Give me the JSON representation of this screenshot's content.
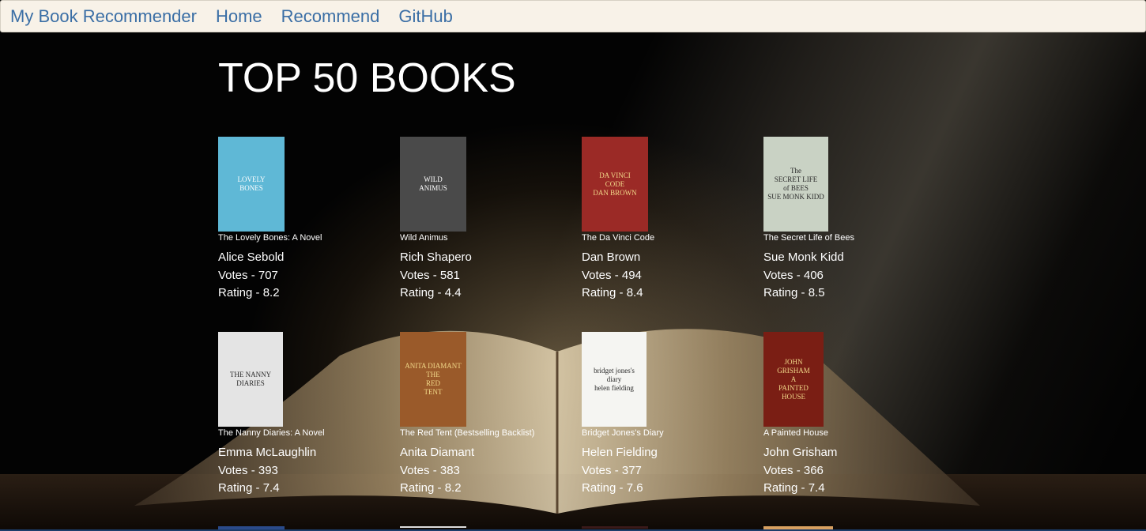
{
  "nav": {
    "brand": "My Book Recommender",
    "links": [
      "Home",
      "Recommend",
      "GitHub"
    ]
  },
  "page": {
    "title": "TOP 50 BOOKS"
  },
  "books": [
    {
      "title": "The Lovely Bones: A Novel",
      "author": "Alice Sebold",
      "votes": "Votes - 707",
      "rating": "Rating - 8.2",
      "cover_text": [
        "LOVELY",
        "BONES"
      ],
      "cover_color": "#5fb8d6"
    },
    {
      "title": "Wild Animus",
      "author": "Rich Shapero",
      "votes": "Votes - 581",
      "rating": "Rating - 4.4",
      "cover_text": [
        "WILD",
        "ANIMUS"
      ],
      "cover_color": "#4a4a4a"
    },
    {
      "title": "The Da Vinci Code",
      "author": "Dan Brown",
      "votes": "Votes - 494",
      "rating": "Rating - 8.4",
      "cover_text": [
        "DA VINCI",
        "CODE",
        "DAN BROWN"
      ],
      "cover_color": "#9b2a26"
    },
    {
      "title": "The Secret Life of Bees",
      "author": "Sue Monk Kidd",
      "votes": "Votes - 406",
      "rating": "Rating - 8.5",
      "cover_text": [
        "The",
        "SECRET LIFE",
        "of BEES",
        "SUE MONK KIDD"
      ],
      "cover_color": "#c9d2c4"
    },
    {
      "title": "The Nanny Diaries: A Novel",
      "author": "Emma McLaughlin",
      "votes": "Votes - 393",
      "rating": "Rating - 7.4",
      "cover_text": [
        "THE NANNY",
        "DIARIES"
      ],
      "cover_color": "#e4e4e4"
    },
    {
      "title": "The Red Tent (Bestselling Backlist)",
      "author": "Anita Diamant",
      "votes": "Votes - 383",
      "rating": "Rating - 8.2",
      "cover_text": [
        "ANITA DIAMANT",
        "THE",
        "RED",
        "TENT"
      ],
      "cover_color": "#9a5a2a"
    },
    {
      "title": "Bridget Jones's Diary",
      "author": "Helen Fielding",
      "votes": "Votes - 377",
      "rating": "Rating - 7.6",
      "cover_text": [
        "bridget jones's",
        "diary",
        "helen fielding"
      ],
      "cover_color": "#f5f5f2"
    },
    {
      "title": "A Painted House",
      "author": "John Grisham",
      "votes": "Votes - 366",
      "rating": "Rating - 7.4",
      "cover_text": [
        "JOHN",
        "GRISHAM",
        "A",
        "PAINTED",
        "HOUSE"
      ],
      "cover_color": "#7a1e14"
    }
  ],
  "colors": {
    "nav_bg": "#f8f2e8",
    "nav_link": "#3a6ea5",
    "page_bg": "#030303"
  }
}
